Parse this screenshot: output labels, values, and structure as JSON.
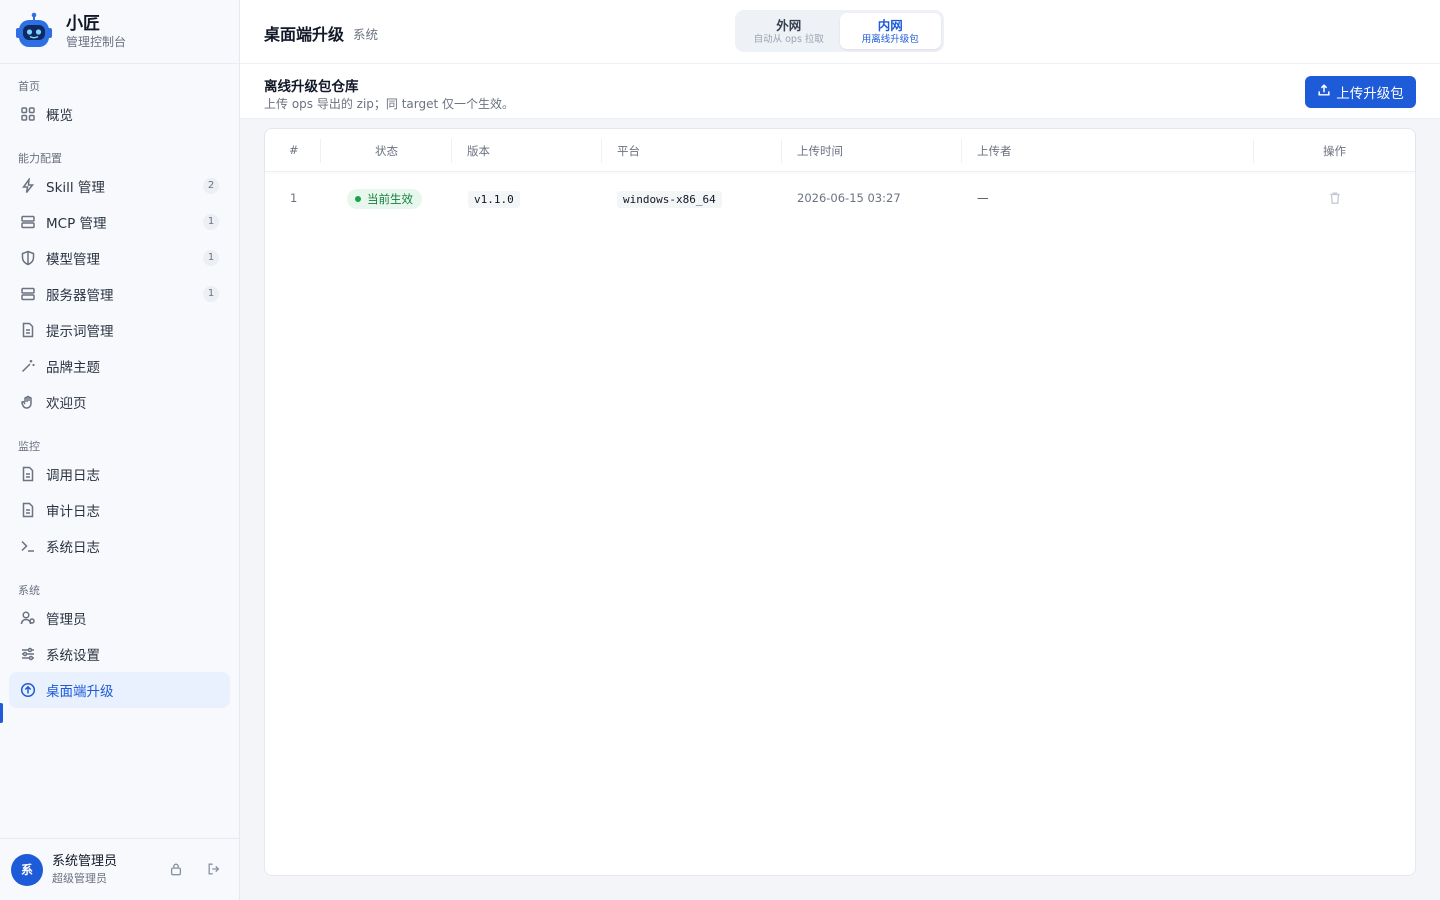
{
  "brand": {
    "name": "小匠",
    "subtitle": "管理控制台"
  },
  "sidebar": {
    "groups": [
      {
        "label": "首页"
      },
      {
        "label": "能力配置"
      },
      {
        "label": "监控"
      },
      {
        "label": "系统"
      }
    ],
    "items": [
      {
        "label": "概览",
        "icon": "grid-icon"
      },
      {
        "label": "Skill 管理",
        "icon": "lightning-icon",
        "badge": "2"
      },
      {
        "label": "MCP 管理",
        "icon": "server-icon",
        "badge": "1"
      },
      {
        "label": "模型管理",
        "icon": "shield-icon",
        "badge": "1"
      },
      {
        "label": "服务器管理",
        "icon": "server-icon",
        "badge": "1"
      },
      {
        "label": "提示词管理",
        "icon": "document-icon"
      },
      {
        "label": "品牌主题",
        "icon": "magic-wand-icon"
      },
      {
        "label": "欢迎页",
        "icon": "wave-hand-icon"
      },
      {
        "label": "调用日志",
        "icon": "document-icon"
      },
      {
        "label": "审计日志",
        "icon": "document-icon"
      },
      {
        "label": "系统日志",
        "icon": "terminal-icon"
      },
      {
        "label": "管理员",
        "icon": "users-icon"
      },
      {
        "label": "系统设置",
        "icon": "sliders-icon"
      },
      {
        "label": "桌面端升级",
        "icon": "arrow-up-circle-icon",
        "active": true
      }
    ]
  },
  "user": {
    "avatar": "系",
    "name": "系统管理员",
    "role": "超级管理员"
  },
  "header": {
    "title": "桌面端升级",
    "crumb": "系统",
    "tabs": [
      {
        "label": "外网",
        "sub": "自动从 ops 拉取"
      },
      {
        "label": "内网",
        "sub": "用离线升级包",
        "active": true
      }
    ]
  },
  "section": {
    "title": "离线升级包仓库",
    "description": "上传 ops 导出的 zip；同 target 仅一个生效。",
    "upload_label": "上传升级包"
  },
  "table": {
    "columns": [
      "#",
      "状态",
      "版本",
      "平台",
      "上传时间",
      "上传者",
      "操作"
    ],
    "rows": [
      {
        "index": "1",
        "status": "当前生效",
        "version": "v1.1.0",
        "platform": "windows-x86_64",
        "uploaded_at": "2026-06-15 03:27",
        "uploader": "—"
      }
    ]
  },
  "colors": {
    "accent": "#1d5bd8",
    "success": "#16a34a"
  }
}
